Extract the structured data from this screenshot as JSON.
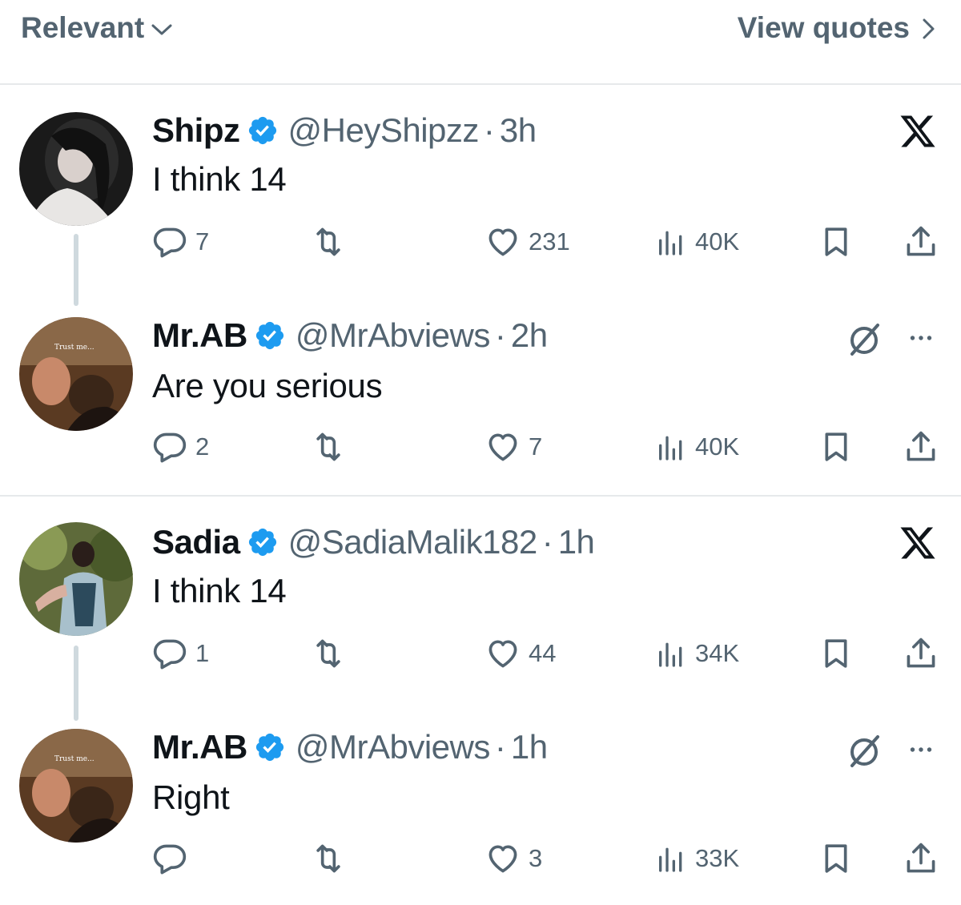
{
  "header": {
    "sort_label": "Relevant",
    "view_quotes_label": "View quotes"
  },
  "tweets": [
    {
      "name": "Shipz",
      "handle": "@HeyShipzz",
      "separator": "·",
      "time": "3h",
      "text": "I think 14",
      "replies": "7",
      "reposts": "",
      "likes": "231",
      "views": "40K",
      "top_right_icon": "x-logo-icon"
    },
    {
      "name": "Mr.AB",
      "handle": "@MrAbviews",
      "separator": "·",
      "time": "2h",
      "text": "Are you serious",
      "replies": "2",
      "reposts": "",
      "likes": "7",
      "views": "40K",
      "top_right_icon": "grok-icon"
    },
    {
      "name": "Sadia",
      "handle": "@SadiaMalik182",
      "separator": "·",
      "time": "1h",
      "text": "I think 14",
      "replies": "1",
      "reposts": "",
      "likes": "44",
      "views": "34K",
      "top_right_icon": "x-logo-icon"
    },
    {
      "name": "Mr.AB",
      "handle": "@MrAbviews",
      "separator": "·",
      "time": "1h",
      "text": "Right",
      "replies": "",
      "reposts": "",
      "likes": "3",
      "views": "33K",
      "top_right_icon": "grok-icon"
    }
  ],
  "colors": {
    "verified_blue": "#1d9bf0",
    "secondary_text": "#536471",
    "primary_text": "#0f1419",
    "divider": "#e6e9eb",
    "thread_line": "#cfd9de"
  }
}
